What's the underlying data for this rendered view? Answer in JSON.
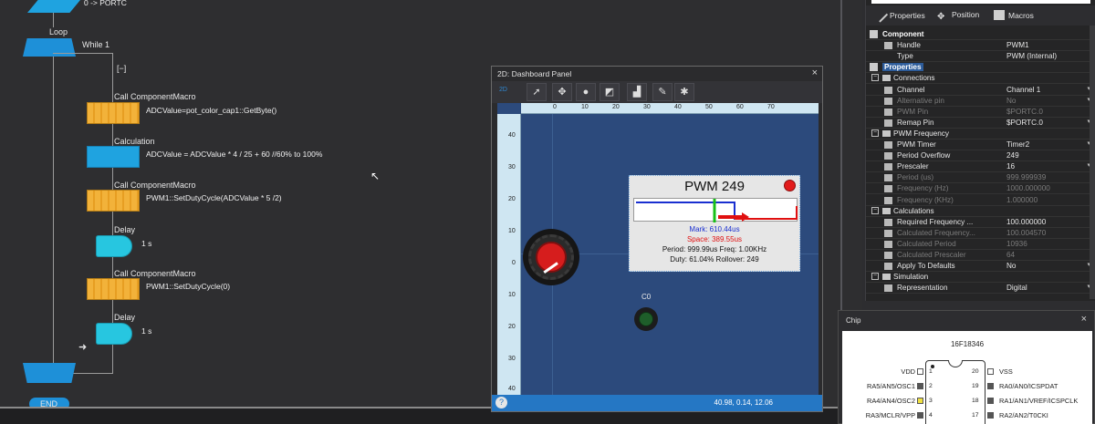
{
  "flowchart": {
    "top_label": "0 -> PORTC",
    "loop_label": "Loop",
    "loop_condition": "While 1",
    "loop_toggle": "[−]",
    "blocks": [
      {
        "type": "macro",
        "label": "Call ComponentMacro",
        "text": "ADCValue=pot_color_cap1::GetByte()"
      },
      {
        "type": "calc",
        "label": "Calculation",
        "text": "ADCValue = ADCValue * 4 / 25 + 60 //60% to 100%"
      },
      {
        "type": "macro",
        "label": "Call ComponentMacro",
        "text": "PWM1::SetDutyCycle(ADCValue * 5 /2)"
      },
      {
        "type": "delay",
        "label": "Delay",
        "text": "1 s"
      },
      {
        "type": "macro",
        "label": "Call ComponentMacro",
        "text": "PWM1::SetDutyCycle(0)"
      },
      {
        "type": "delay",
        "label": "Delay",
        "text": "1 s"
      }
    ],
    "end_label": "END"
  },
  "dashboard": {
    "title": "2D: Dashboard Panel",
    "close": "×",
    "mode_label": "2D",
    "toolbar_icons": [
      "pointer-icon",
      "move-icon",
      "sphere-icon",
      "zoom-fit-icon",
      "camera-icon",
      "wrench-icon",
      "tools-icon"
    ],
    "ruler_top": [
      "0",
      "10",
      "20",
      "30",
      "40",
      "50",
      "60",
      "70"
    ],
    "ruler_left": [
      "40",
      "30",
      "20",
      "10",
      "0",
      "10",
      "20",
      "30",
      "40"
    ],
    "status_coords": "40.98, 0.14, 12.06",
    "help": "?",
    "pwm_widget": {
      "title": "PWM 249",
      "mark": "Mark: 610.44us",
      "space": "Space: 389.55us",
      "period_freq": "Period: 999.99us   Freq: 1.00KHz",
      "duty_rollover": "Duty: 61.04%    Rollover: 249",
      "colors": {
        "mark": "#1a2fd0",
        "space": "#e01010",
        "led": "#e21b1b"
      }
    },
    "led_label": "C0"
  },
  "properties": {
    "tabs": [
      {
        "label": "Properties",
        "icon": "wrench-icon"
      },
      {
        "label": "Position",
        "icon": "move-icon"
      },
      {
        "label": "Macros",
        "icon": "film-icon"
      }
    ],
    "rows": [
      {
        "kind": "head",
        "key": "Component",
        "value": ""
      },
      {
        "kind": "row",
        "key": "Handle",
        "value": "PWM1",
        "icon": "pen-icon"
      },
      {
        "kind": "row",
        "key": "Type",
        "value": "PWM (Internal)",
        "icon": ""
      },
      {
        "kind": "head-sel",
        "key": "Properties",
        "value": ""
      },
      {
        "kind": "sec",
        "key": "Connections",
        "value": ""
      },
      {
        "kind": "row",
        "key": "Channel",
        "value": "Channel 1",
        "icon": "list-icon",
        "dd": true
      },
      {
        "kind": "dim",
        "key": "Alternative pin",
        "value": "No",
        "icon": "plus-icon",
        "dd": true
      },
      {
        "kind": "dim",
        "key": "PWM Pin",
        "value": "$PORTC.0",
        "icon": "list-icon"
      },
      {
        "kind": "row",
        "key": "Remap Pin",
        "value": "$PORTC.0",
        "icon": "chip-icon",
        "dd": true
      },
      {
        "kind": "sec",
        "key": "PWM Frequency",
        "value": ""
      },
      {
        "kind": "row",
        "key": "PWM Timer",
        "value": "Timer2",
        "icon": "list-icon",
        "dd": true
      },
      {
        "kind": "row",
        "key": "Period Overflow",
        "value": "249",
        "icon": "z-icon"
      },
      {
        "kind": "row",
        "key": "Prescaler",
        "value": "16",
        "icon": "list-icon",
        "dd": true
      },
      {
        "kind": "dim",
        "key": "Period (us)",
        "value": "999.999939",
        "icon": "r-icon"
      },
      {
        "kind": "dim",
        "key": "Frequency (Hz)",
        "value": "1000.000000",
        "icon": "r-icon"
      },
      {
        "kind": "dim",
        "key": "Frequency (KHz)",
        "value": "1.000000",
        "icon": "r-icon"
      },
      {
        "kind": "sec",
        "key": "Calculations",
        "value": ""
      },
      {
        "kind": "row",
        "key": "Required Frequency ...",
        "value": "100.000000",
        "icon": "r-icon"
      },
      {
        "kind": "dim",
        "key": "Calculated Frequency...",
        "value": "100.004570",
        "icon": "r-icon"
      },
      {
        "kind": "dim",
        "key": "Calculated Period",
        "value": "10936",
        "icon": "z-icon"
      },
      {
        "kind": "dim",
        "key": "Calculated Prescaler",
        "value": "64",
        "icon": "z-icon"
      },
      {
        "kind": "row",
        "key": "Apply To Defaults",
        "value": "No",
        "icon": "plus-icon",
        "dd": true
      },
      {
        "kind": "sec",
        "key": "Simulation",
        "value": ""
      },
      {
        "kind": "row",
        "key": "Representation",
        "value": "Digital",
        "icon": "list-icon",
        "dd": true
      }
    ]
  },
  "chip": {
    "title": "Chip",
    "close": "×",
    "name": "16F18346",
    "left_pins": [
      {
        "label": "VDD",
        "num": "1",
        "state": "off"
      },
      {
        "label": "RA5/AN5/OSC1",
        "num": "2",
        "state": "on"
      },
      {
        "label": "RA4/AN4/OSC2",
        "num": "3",
        "state": "yel"
      },
      {
        "label": "RA3/MCLR/VPP",
        "num": "4",
        "state": "on"
      }
    ],
    "right_pins": [
      {
        "label": "VSS",
        "num": "20",
        "state": "off"
      },
      {
        "label": "RA0/AN0/ICSPDAT",
        "num": "19",
        "state": "on"
      },
      {
        "label": "RA1/AN1/VREF/ICSPCLK",
        "num": "18",
        "state": "on"
      },
      {
        "label": "RA2/AN2/T0CKI",
        "num": "17",
        "state": "on"
      }
    ]
  }
}
